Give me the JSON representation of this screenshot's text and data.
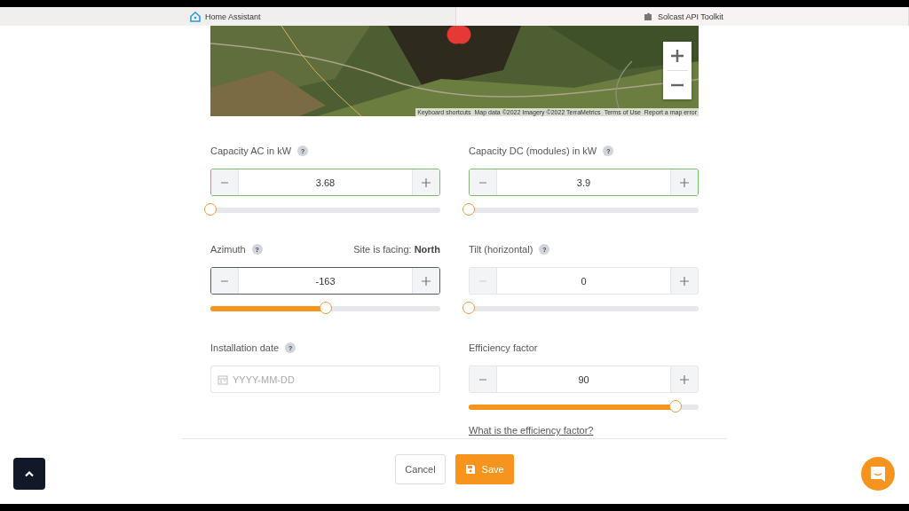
{
  "browser_tabs": [
    {
      "title": "Home Assistant",
      "kind": "house"
    },
    {
      "title": "Solcast API Toolkit",
      "kind": "puzzle"
    }
  ],
  "map": {
    "kind": "picture",
    "attribution": [
      "Keyboard shortcuts",
      "Map data ©2022 Imagery ©2022 TerraMetrics",
      "Terms of Use",
      "Report a map error"
    ]
  },
  "fields": [
    {
      "kind": "stepper",
      "label": "Capacity AC in kW",
      "help": "?",
      "value": "3.68",
      "valid": true,
      "focused": false,
      "minus_disabled": false,
      "level": 0
    },
    {
      "kind": "stepper",
      "label": "Capacity DC (modules) in kW",
      "help": "?",
      "value": "3.9",
      "valid": true,
      "focused": false,
      "minus_disabled": false,
      "level": 0
    },
    {
      "kind": "stepper",
      "label": "Azimuth",
      "help": "?",
      "facing_label": "Site is facing:",
      "facing_value": "North",
      "value": "-163",
      "valid": false,
      "focused": true,
      "minus_disabled": false,
      "level": 0.5
    },
    {
      "kind": "stepper",
      "label": "Tilt (horizontal)",
      "help": "?",
      "value": "0",
      "valid": false,
      "focused": false,
      "minus_disabled": true,
      "level": 0
    },
    {
      "kind": "date",
      "label": "Installation date",
      "help": "?",
      "placeholder": "YYYY-MM-DD"
    },
    {
      "kind": "stepper",
      "label": "Efficiency factor",
      "value": "90",
      "valid": false,
      "focused": false,
      "minus_disabled": false,
      "level": 0.9,
      "link": "What is the efficiency factor?"
    }
  ],
  "buttons": [
    {
      "kind": "cancel",
      "label": "Cancel"
    },
    {
      "kind": "save",
      "label": "Save"
    }
  ]
}
